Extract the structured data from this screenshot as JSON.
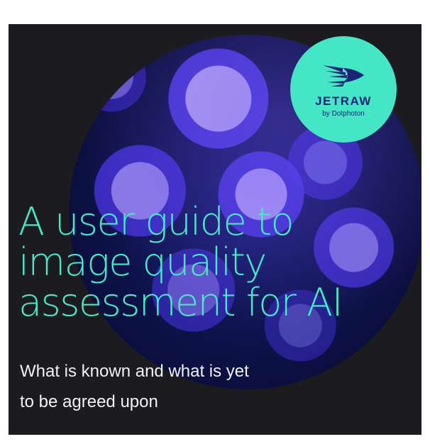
{
  "colors": {
    "background": "#1c1b1f",
    "accent_teal": "#48e7c7",
    "logo_badge": "#45e6c6",
    "logo_text": "#1a2577",
    "subtitle_text": "#f2f2f2",
    "hero_blue": "#1a1d74"
  },
  "logo": {
    "icon": "bird-logo-icon",
    "name": "JETRAW",
    "byline": "by Dotphoton"
  },
  "headline": {
    "line1": "A user guide to",
    "line2": "image quality",
    "line3": "assessment for AI"
  },
  "subtitle": {
    "line1": "What is known and what is yet",
    "line2": "to be agreed upon"
  }
}
